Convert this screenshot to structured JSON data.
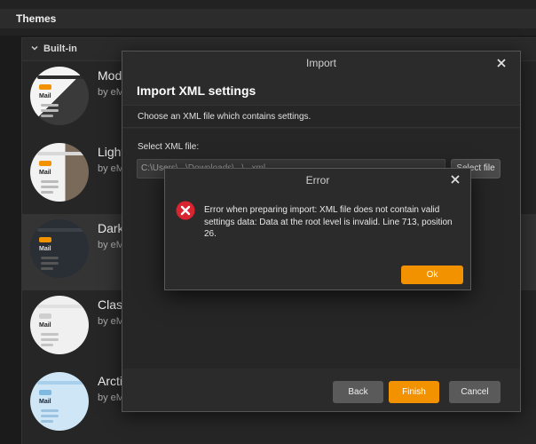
{
  "window": {
    "title": "Themes"
  },
  "theme_list": {
    "section_label": "Built-in",
    "items": [
      {
        "name": "Mod",
        "author": "by eM",
        "thumb_text": "Mail"
      },
      {
        "name": "Light",
        "author": "by eM",
        "thumb_text": "Mail"
      },
      {
        "name": "Dark",
        "author": "by eM",
        "thumb_text": "Mail"
      },
      {
        "name": "Class",
        "author": "by eM",
        "thumb_text": "Mail"
      },
      {
        "name": "Arctic",
        "author": "by eM",
        "thumb_text": "Mail"
      }
    ]
  },
  "import_dialog": {
    "title": "Import",
    "heading": "Import XML settings",
    "subtitle": "Choose an XML file which contains settings.",
    "select_label": "Select XML file:",
    "file_path_value": "C:\\Users\\...\\Downloads\\...\\...xml",
    "select_file_label": "Select file",
    "back_label": "Back",
    "finish_label": "Finish",
    "cancel_label": "Cancel"
  },
  "error_dialog": {
    "title": "Error",
    "message": "Error when preparing import: XML file does not contain valid settings data: Data at the root level is invalid. Line 713, position 26.",
    "ok_label": "Ok"
  },
  "colors": {
    "accent": "#f39200",
    "error_red": "#d9252f",
    "background": "#1b1b1b",
    "dialog": "#2b2b2b"
  },
  "icons": {
    "chevron": "chevron-down-icon",
    "close": "close-icon",
    "error": "error-circle-icon"
  }
}
